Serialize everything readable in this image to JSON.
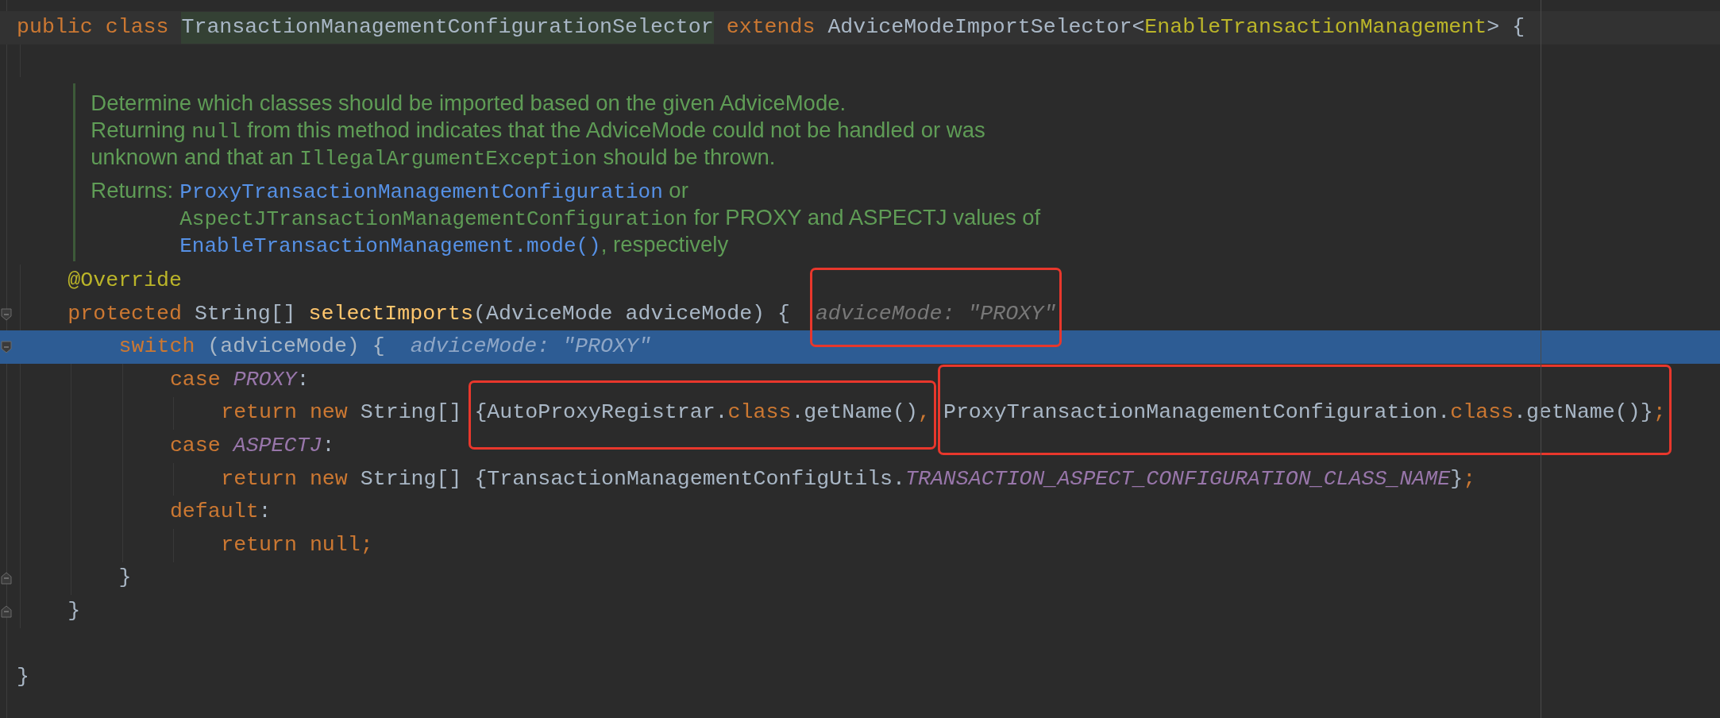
{
  "editor": {
    "lines": [
      {
        "kind": "code",
        "current": true,
        "tokens": [
          {
            "kind": "kw",
            "text": "public class "
          },
          {
            "kind": "ident",
            "text": "TransactionManagementConfigurationSelector",
            "highlighted": true,
            "caret": true
          },
          {
            "kind": "kw",
            "text": " extends"
          },
          {
            "kind": "plain",
            "text": " AdviceModeImportSelector<"
          },
          {
            "kind": "generic",
            "text": "EnableTransactionManagement"
          },
          {
            "kind": "plain",
            "text": "> {"
          }
        ],
        "children": [
          {
            "kind": "blank"
          },
          {
            "kind": "doc",
            "paragraphs": [
              [
                {
                  "kind": "text",
                  "text": "Determine which classes should be imported based on the given AdviceMode."
                }
              ],
              [
                {
                  "kind": "text",
                  "text": "Returning "
                },
                {
                  "kind": "code",
                  "text": "null"
                },
                {
                  "kind": "text",
                  "text": " from this method indicates that the AdviceMode could not be handled or was"
                }
              ],
              [
                {
                  "kind": "text",
                  "text": "unknown and that an "
                },
                {
                  "kind": "code",
                  "text": "IllegalArgumentException"
                },
                {
                  "kind": "text",
                  "text": " should be thrown."
                }
              ]
            ],
            "returns": {
              "label": "Returns:",
              "lines": [
                [
                  {
                    "kind": "link",
                    "text": "ProxyTransactionManagementConfiguration"
                  },
                  {
                    "kind": "text",
                    "text": " or"
                  }
                ],
                [
                  {
                    "kind": "code",
                    "text": "AspectJTransactionManagementConfiguration"
                  },
                  {
                    "kind": "text",
                    "text": " for PROXY and ASPECTJ values of"
                  }
                ],
                [
                  {
                    "kind": "link",
                    "text": "EnableTransactionManagement.mode()"
                  },
                  {
                    "kind": "text",
                    "text": ", respectively"
                  }
                ]
              ]
            }
          },
          {
            "kind": "code",
            "tokens": [
              {
                "kind": "annotation",
                "text": "@Override"
              }
            ]
          },
          {
            "kind": "code",
            "fold_start": true,
            "tokens": [
              {
                "kind": "kw",
                "text": "protected "
              },
              {
                "kind": "plain",
                "text": "String[] "
              },
              {
                "kind": "method",
                "text": "selectImports"
              },
              {
                "kind": "plain",
                "text": "(AdviceMode adviceMode) {  "
              },
              {
                "kind": "box",
                "tokens": [
                  {
                    "kind": "hint",
                    "text": "adviceMode: \"PROXY\""
                  }
                ]
              }
            ],
            "children": [
              {
                "kind": "code",
                "fold_start": true,
                "execution_point": true,
                "tokens": [
                  {
                    "kind": "kw",
                    "text": "switch "
                  },
                  {
                    "kind": "plain",
                    "text": "(adviceMode) {  "
                  },
                  {
                    "kind": "hint",
                    "text": "adviceMode: \"PROXY\""
                  }
                ],
                "children": [
                  {
                    "kind": "code",
                    "tokens": [
                      {
                        "kind": "kw",
                        "text": "case "
                      },
                      {
                        "kind": "const",
                        "text": "PROXY"
                      },
                      {
                        "kind": "plain",
                        "text": ":"
                      }
                    ],
                    "children": [
                      {
                        "kind": "code",
                        "tokens": [
                          {
                            "kind": "kw",
                            "text": "return new "
                          },
                          {
                            "kind": "plain",
                            "text": "String[] "
                          },
                          {
                            "kind": "box",
                            "tokens": [
                              {
                                "kind": "plain",
                                "text": "{AutoProxyRegistrar."
                              },
                              {
                                "kind": "kw",
                                "text": "class"
                              },
                              {
                                "kind": "plain",
                                "text": ".getName()"
                              },
                              {
                                "kind": "kw",
                                "text": ","
                              }
                            ]
                          },
                          {
                            "kind": "box",
                            "tokens": [
                              {
                                "kind": "plain",
                                "text": "ProxyTransactionManagementConfiguration."
                              },
                              {
                                "kind": "kw",
                                "text": "class"
                              },
                              {
                                "kind": "plain",
                                "text": ".getName()}"
                              },
                              {
                                "kind": "kw",
                                "text": ";"
                              }
                            ]
                          }
                        ]
                      }
                    ]
                  },
                  {
                    "kind": "code",
                    "tokens": [
                      {
                        "kind": "kw",
                        "text": "case "
                      },
                      {
                        "kind": "const",
                        "text": "ASPECTJ"
                      },
                      {
                        "kind": "plain",
                        "text": ":"
                      }
                    ],
                    "children": [
                      {
                        "kind": "code",
                        "tokens": [
                          {
                            "kind": "kw",
                            "text": "return new "
                          },
                          {
                            "kind": "plain",
                            "text": "String[] {TransactionManagementConfigUtils."
                          },
                          {
                            "kind": "const",
                            "text": "TRANSACTION_ASPECT_CONFIGURATION_CLASS_NAME"
                          },
                          {
                            "kind": "plain",
                            "text": "}"
                          },
                          {
                            "kind": "kw",
                            "text": ";"
                          }
                        ]
                      }
                    ]
                  },
                  {
                    "kind": "code",
                    "tokens": [
                      {
                        "kind": "kw",
                        "text": "default"
                      },
                      {
                        "kind": "plain",
                        "text": ":"
                      }
                    ],
                    "children": [
                      {
                        "kind": "code",
                        "tokens": [
                          {
                            "kind": "kw",
                            "text": "return null;"
                          }
                        ]
                      }
                    ]
                  }
                ]
              },
              {
                "kind": "code",
                "fold_end": true,
                "tokens": [
                  {
                    "kind": "plain",
                    "text": "}"
                  }
                ]
              }
            ]
          },
          {
            "kind": "code",
            "fold_end": true,
            "tokens": [
              {
                "kind": "plain",
                "text": "}"
              }
            ]
          }
        ]
      },
      {
        "kind": "blank"
      },
      {
        "kind": "code",
        "tokens": [
          {
            "kind": "plain",
            "text": "}"
          }
        ]
      }
    ]
  }
}
